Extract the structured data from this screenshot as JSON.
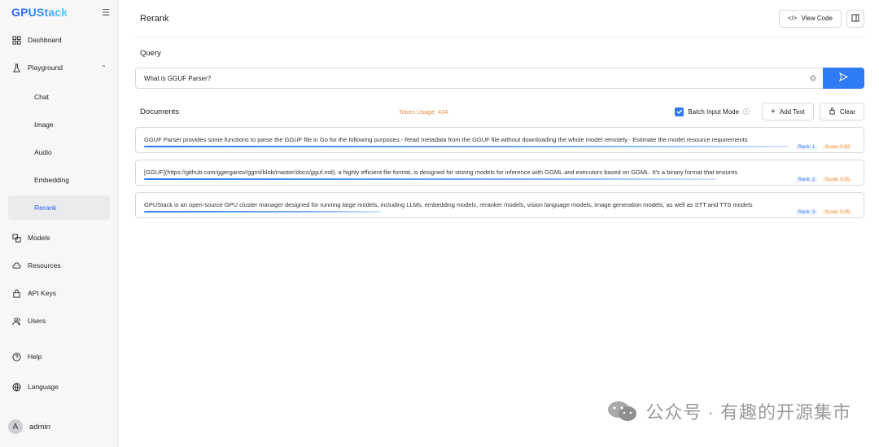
{
  "sidebar": {
    "logo": "GPUStack",
    "items": [
      {
        "label": "Dashboard"
      },
      {
        "label": "Playground"
      },
      {
        "label": "Chat"
      },
      {
        "label": "Image"
      },
      {
        "label": "Audio"
      },
      {
        "label": "Embedding"
      },
      {
        "label": "Rerank"
      },
      {
        "label": "Models"
      },
      {
        "label": "Resources"
      },
      {
        "label": "API Keys"
      },
      {
        "label": "Users"
      },
      {
        "label": "Help"
      },
      {
        "label": "Language"
      }
    ],
    "user": {
      "initial": "A",
      "name": "admin"
    }
  },
  "header": {
    "title": "Rerank",
    "view_code_label": "View Code"
  },
  "query": {
    "label": "Query",
    "value": "What is GGUF Parser?"
  },
  "documents": {
    "label": "Documents",
    "token_usage": "Token Usage: 434",
    "batch_mode_label": "Batch Input Mode",
    "batch_mode_checked": true,
    "add_text_label": "Add Text",
    "clear_label": "Clear",
    "items": [
      {
        "text": "GGUF Parser provides some functions to parse the GGUF file in Go for the following purposes:- Read metadata from the GGUF file without downloading the whole model remotely.- Estimate the model resource requirements",
        "rank": "Rank: 1",
        "score": "Score: 0.62",
        "relevance": 0.62
      },
      {
        "text": "[GGUF](https://github.com/ggerganov/ggml/blob/master/docs/gguf.md), a highly efficient file format, is designed for storing models for inference with GGML and executors based on GGML. It's a binary format that ensures",
        "rank": "Rank: 2",
        "score": "Score: 0.55",
        "relevance": 0.55
      },
      {
        "text": "GPUStack is an open-source GPU cluster manager designed for running large models, including LLMs, embedding models, reranker models, vision language models, image generation models, as well as STT and TTS models",
        "rank": "Rank: 3",
        "score": "Score: 0.09",
        "relevance": 0.09
      }
    ]
  },
  "watermark": {
    "text": "公众号 · 有趣的开源集市"
  },
  "colors": {
    "accent": "#2f7bf5",
    "token_orange": "#e8893d",
    "sidebar_bg": "#f7f7f8"
  }
}
